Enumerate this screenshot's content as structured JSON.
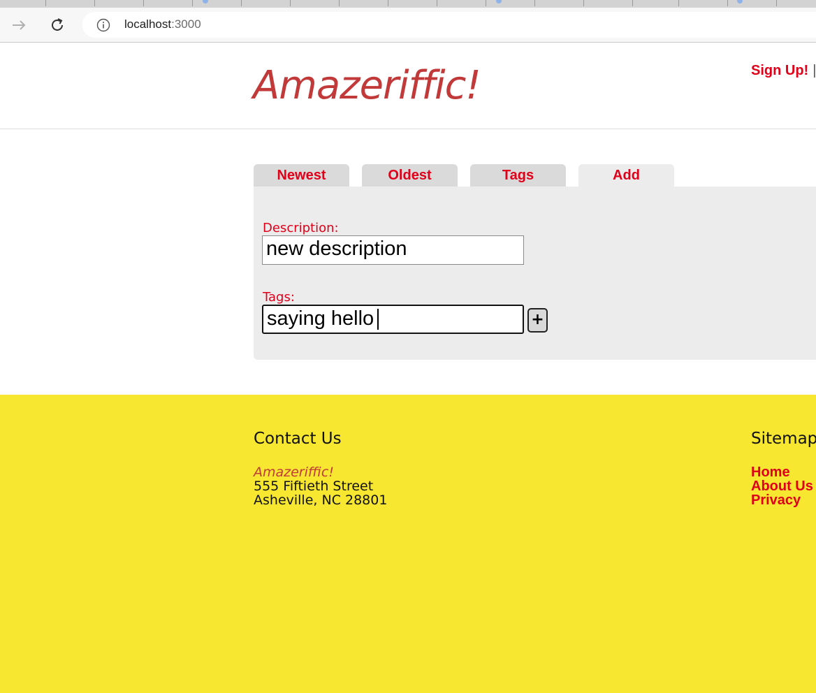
{
  "browser": {
    "url_host": "localhost",
    "url_port": ":3000"
  },
  "header": {
    "logo": "Amazeriffic!",
    "signup_link": "Sign Up!",
    "separator": "|"
  },
  "tabs": [
    {
      "label": "Newest",
      "active": false
    },
    {
      "label": "Oldest",
      "active": false
    },
    {
      "label": "Tags",
      "active": false
    },
    {
      "label": "Add",
      "active": true
    }
  ],
  "form": {
    "description_label": "Description:",
    "description_value": "new description",
    "tags_label": "Tags:",
    "tags_value": "saying hello",
    "add_tag_button": "+"
  },
  "footer": {
    "contact_title": "Contact Us",
    "company": "Amazeriffic!",
    "street": "555 Fiftieth Street",
    "city": "Asheville, NC 28801",
    "sitemap_title": "Sitemap",
    "sitemap_links": [
      "Home",
      "About Us",
      "Privacy"
    ]
  },
  "colors": {
    "accent_red": "#e0001a",
    "logo_red": "#c2393a",
    "footer_yellow": "#f7e731",
    "panel_gray": "#ececec"
  },
  "icons": [
    "forward-arrow-icon",
    "reload-icon",
    "info-icon"
  ]
}
